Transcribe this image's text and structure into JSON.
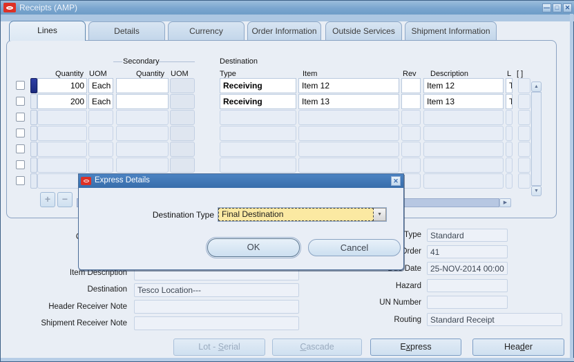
{
  "window": {
    "title": "Receipts (AMP)"
  },
  "icons": {
    "minimize": "—",
    "maximize": "□",
    "close": "✕",
    "combo_arrow": "▼",
    "scroll_up": "▲",
    "scroll_down": "▼",
    "scroll_right": "▶",
    "add": "+",
    "remove": "−"
  },
  "tabs": [
    {
      "label": "Lines"
    },
    {
      "label": "Details"
    },
    {
      "label": "Currency"
    },
    {
      "label": "Order Information"
    },
    {
      "label": "Outside Services"
    },
    {
      "label": "Shipment Information"
    }
  ],
  "table": {
    "group_label": "Secondary",
    "headers": {
      "quantity": "Quantity",
      "uom": "UOM",
      "secondary_quantity": "Quantity",
      "secondary_uom": "UOM",
      "destination_line1": "Destination",
      "destination_line2": "Type",
      "item": "Item",
      "rev": "Rev",
      "description": "Description",
      "truncated_col": "L",
      "flexfield": "[ ]"
    },
    "rows": [
      {
        "quantity": "100",
        "uom": "Each",
        "secondary_quantity": "",
        "secondary_uom": "",
        "destination_type": "Receiving",
        "item": "Item 12",
        "rev": "",
        "description": "Item 12",
        "truncated": "T"
      },
      {
        "quantity": "200",
        "uom": "Each",
        "secondary_quantity": "",
        "secondary_uom": "",
        "destination_type": "Receiving",
        "item": "Item 13",
        "rev": "",
        "description": "Item 13",
        "truncated": "T"
      }
    ],
    "empty_row_count": 5
  },
  "dialog": {
    "title": "Express Details",
    "destination_type_label": "Destination Type",
    "destination_type_value": "Final Destination",
    "ok": "OK",
    "cancel": "Cancel"
  },
  "details_left": {
    "operating_unit_label": "Operating Unit",
    "item_description_label": "Item Description",
    "destination_label": "Destination",
    "destination_value": "Tesco Location---",
    "header_receiver_note_label": "Header Receiver Note",
    "header_receiver_note_value": "",
    "shipment_receiver_note_label": "Shipment Receiver Note",
    "shipment_receiver_note_value": ""
  },
  "details_right": {
    "order_type_label": "Order Type",
    "order_type_value": "Standard",
    "order_label": "Order",
    "order_value": "41",
    "due_date_label": "Due Date",
    "due_date_value": "25-NOV-2014 00:00",
    "hazard_label": "Hazard",
    "hazard_value": "",
    "un_number_label": "UN Number",
    "un_number_value": "",
    "routing_label": "Routing",
    "routing_value": "Standard Receipt"
  },
  "footer": {
    "lot_serial": {
      "pre": "Lot - ",
      "key": "S",
      "post": "erial"
    },
    "cascade": {
      "pre": "",
      "key": "C",
      "post": "ascade"
    },
    "express": {
      "pre": "E",
      "key": "x",
      "post": "press"
    },
    "header": {
      "pre": "Hea",
      "key": "d",
      "post": "er"
    }
  },
  "colors": {
    "titlebar": "#6e9cc7",
    "dialog_titlebar": "#3e74b3",
    "oracle_red": "#dd3126",
    "focus_yellow": "#fbe9a2",
    "selected_row_indicator": "#202f8e",
    "background": "#e9eef5"
  }
}
